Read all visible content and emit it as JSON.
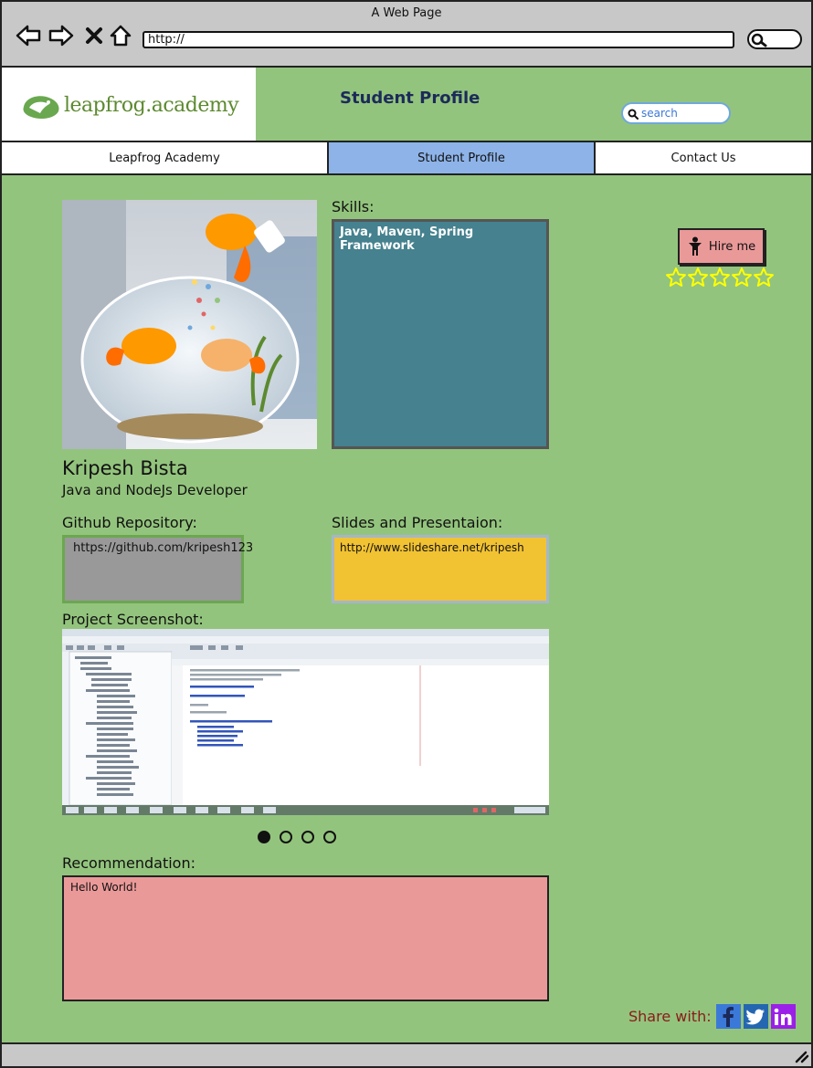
{
  "browser": {
    "title": "A Web Page",
    "url": "http://"
  },
  "header": {
    "logo_text": "leapfrog.academy",
    "page_heading": "Student Profile",
    "search_placeholder": "search"
  },
  "nav": {
    "tabs": [
      {
        "label": "Leapfrog Academy",
        "active": false
      },
      {
        "label": "Student Profile",
        "active": true
      },
      {
        "label": "Contact Us",
        "active": false
      }
    ]
  },
  "profile": {
    "skills_label": "Skills:",
    "skills_value": "Java, Maven, Spring Framework",
    "hire_label": "Hire me",
    "rating": {
      "filled": 0,
      "max": 5
    },
    "name": "Kripesh Bista",
    "role": "Java and NodeJs Developer",
    "github_label": "Github Repository:",
    "github_value": "https://github.com/kripesh123",
    "slides_label": "Slides and Presentaion:",
    "slides_value": "http://www.slideshare.net/kripesh",
    "screenshot_label": "Project Screenshot:",
    "carousel": {
      "count": 4,
      "active_index": 0
    },
    "recommendation_label": "Recommendation:",
    "recommendation_value": "Hello World!"
  },
  "share": {
    "label": "Share with:",
    "icons": [
      "facebook-icon",
      "twitter-icon",
      "linkedin-icon"
    ]
  },
  "colors": {
    "page_bg": "#93c47d",
    "active_tab": "#8db3e8",
    "skills_bg": "#45818e",
    "github_bg": "#999999",
    "slides_bg": "#f1c232",
    "recommendation_bg": "#ea9999",
    "hire_bg": "#ea9999",
    "star": "#ffff00"
  }
}
